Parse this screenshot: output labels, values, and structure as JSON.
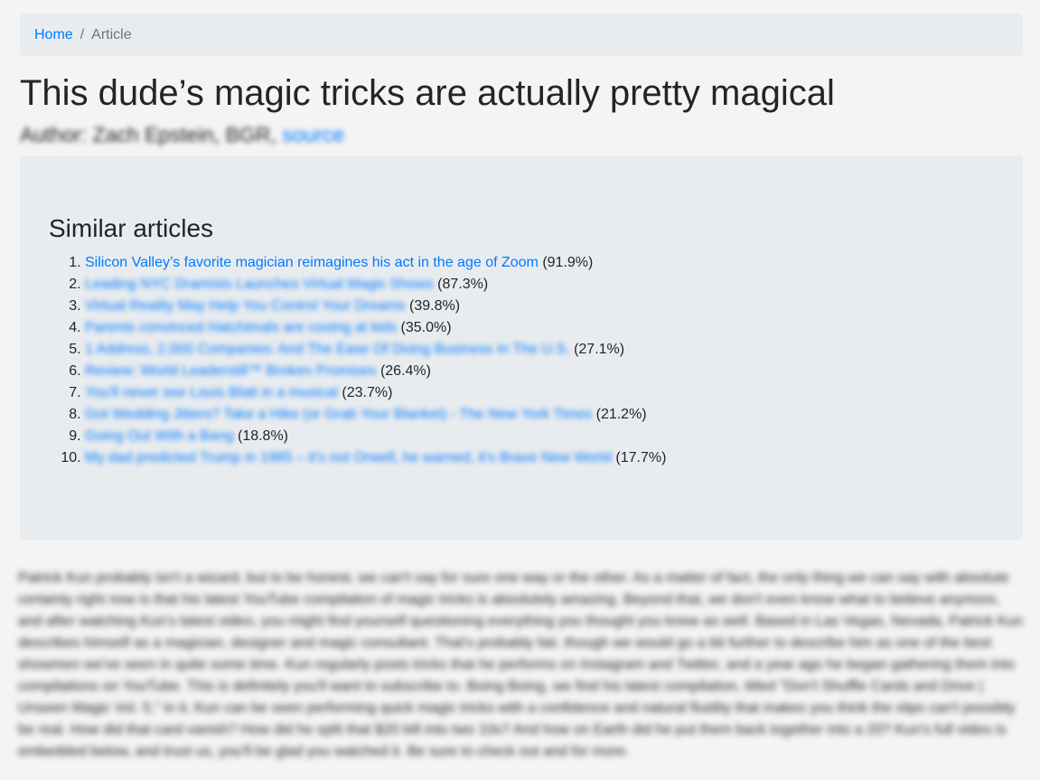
{
  "breadcrumb": {
    "home": "Home",
    "separator": "/",
    "current": "Article"
  },
  "article": {
    "title": "This dude’s magic tricks are actually pretty magical",
    "author_prefix": "Author: Zach Epstein, BGR, ",
    "source_link": "source",
    "body": "Patrick Kun probably isn't a wizard, but to be honest, we can't say for sure one way or the other. As a matter of fact, the only thing we can say with absolute certainty right now is that his latest YouTube compilation of magic tricks is absolutely amazing. Beyond that, we don't even know what to believe anymore, and after watching Kun's latest video, you might find yourself questioning everything you thought you knew as well. Based in Las Vegas, Nevada, Patrick Kun describes himself as a magician, designer and magic consultant. That's probably fair, though we would go a bit further to describe him as one of the best showmen we've seen in quite some time. Kun regularly posts tricks that he performs on Instagram and Twitter, and a year ago he began gathering them into compilations on YouTube. This is definitely you'll want to subscribe to. Boing Boing, we find his latest compilation, titled \"Don't Shuffle Cards and Drive | Unseen Magic Vol. 5,\" in it, Kun can be seen performing quick magic tricks with a confidence and natural fluidity that makes you think the slips can't possibly be real. How did that card vanish? How did he split that $20 bill into two 10s? And how on Earth did he put them back together into a 20? Kun's full video is embedded below, and trust us, you'll be glad you watched it. Be sure to check out and for more."
  },
  "similar": {
    "heading": "Similar articles",
    "items": [
      {
        "title": "Silicon Valley’s favorite magician reimagines his act in the age of Zoom",
        "score": "(91.9%)",
        "blurred": false
      },
      {
        "title": "Leading NYC Dramists Launches Virtual Magic Shows",
        "score": "(87.3%)",
        "blurred": true
      },
      {
        "title": "Virtual Reality May Help You Control Your Dreams",
        "score": "(39.8%)",
        "blurred": true
      },
      {
        "title": "Parents convinced Hatchimals are cooing at kids",
        "score": "(35.0%)",
        "blurred": true
      },
      {
        "title": "1 Address, 2,000 Companies: And The Ease Of Doing Business In The U.S.",
        "score": "(27.1%)",
        "blurred": true
      },
      {
        "title": "Review: World Leaderstill™ Broken Promises",
        "score": "(26.4%)",
        "blurred": true
      },
      {
        "title": "You'll never see Louis Blatt in a musical",
        "score": "(23.7%)",
        "blurred": true
      },
      {
        "title": "Got Wedding Jitters? Take a Hike (or Grab Your Blanket) - The New York Times",
        "score": "(21.2%)",
        "blurred": true
      },
      {
        "title": "Going Out With a Bang",
        "score": "(18.8%)",
        "blurred": true
      },
      {
        "title": "My dad predicted Trump in 1985 – it's not Orwell, he warned, it's Brave New World",
        "score": "(17.7%)",
        "blurred": true
      }
    ]
  }
}
